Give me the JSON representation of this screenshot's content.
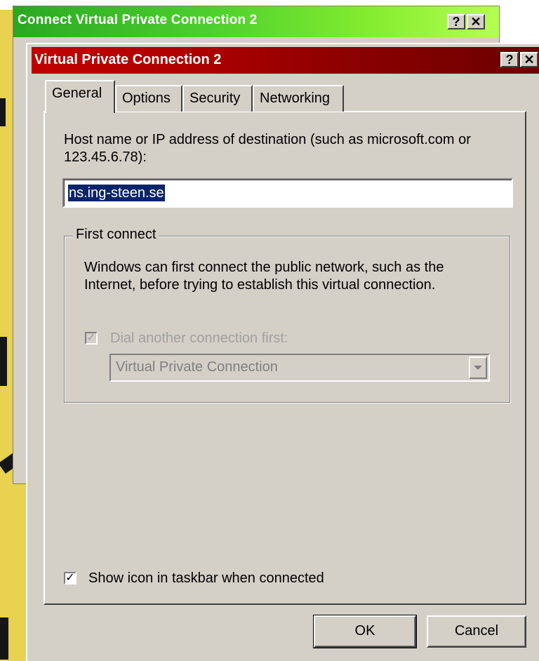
{
  "back_window": {
    "title": "Connect Virtual Private Connection 2",
    "help_label": "?",
    "close_label": "✕"
  },
  "front_window": {
    "title": "Virtual Private Connection 2",
    "help_label": "?",
    "close_label": "✕"
  },
  "tabs": [
    {
      "label": "General",
      "active": true
    },
    {
      "label": "Options",
      "active": false
    },
    {
      "label": "Security",
      "active": false
    },
    {
      "label": "Networking",
      "active": false
    }
  ],
  "general": {
    "host_label_line1": "Host name or IP address of destination (such as microsoft.com or",
    "host_label_line2": "123.45.6.78):",
    "host_value": "ns.ing-steen.se",
    "first_connect": {
      "group_label": "First connect",
      "description_line1": "Windows can first connect the public network, such as the",
      "description_line2": "Internet, before trying to establish this virtual connection.",
      "dial_first_label": "Dial another connection first:",
      "dial_first_checked": true,
      "dial_first_disabled": true,
      "connection_select_value": "Virtual Private Connection"
    },
    "show_icon_label": "Show icon in taskbar when connected",
    "show_icon_checked": true
  },
  "buttons": {
    "ok": "OK",
    "cancel": "Cancel"
  },
  "colors": {
    "dialog_face": "#d4d0c8",
    "back_title_gradient_start": "#29a822",
    "front_title_gradient_start": "#c00000",
    "selection": "#0a246a"
  }
}
